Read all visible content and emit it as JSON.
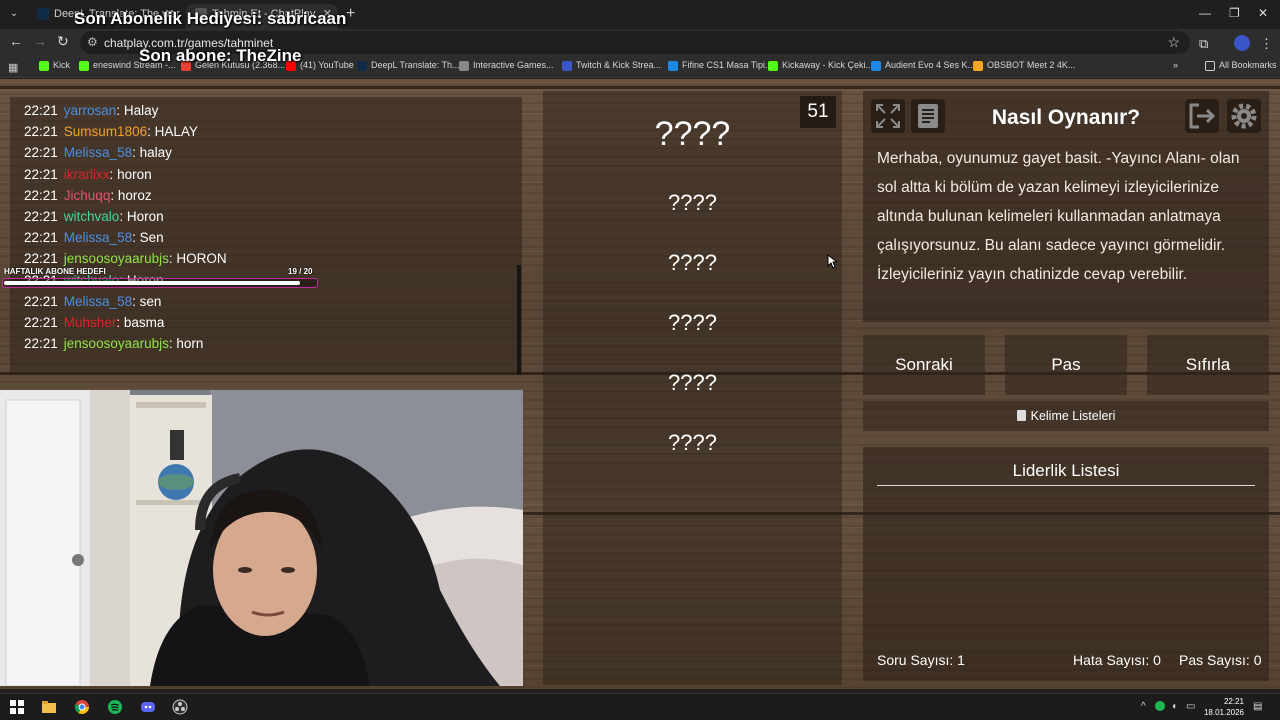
{
  "browser": {
    "tabs": [
      {
        "title": "DeepL Translate: The world's m",
        "favicon_color": "#0f2b46"
      },
      {
        "title": "Tahmin Et - ChatPlay",
        "favicon_color": "#555555"
      }
    ],
    "url": "chatplay.com.tr/games/tahminet",
    "bookmarks": [
      {
        "label": "Kick",
        "color": "#53fc18"
      },
      {
        "label": "eneswind Stream -...",
        "color": "#53fc18"
      },
      {
        "label": "Gelen Kutusu (2.368...",
        "color": "#ea4335"
      },
      {
        "label": "(41) YouTube",
        "color": "#ff0000"
      },
      {
        "label": "DeepL Translate: Th...",
        "color": "#0f2b46"
      },
      {
        "label": "Interactive Games...",
        "color": "#888888"
      },
      {
        "label": "Twitch & Kick Strea...",
        "color": "#3a55c8"
      },
      {
        "label": "Fifine CS1 Masa Tipi...",
        "color": "#1e88e5"
      },
      {
        "label": "Kickaway - Kick Çeki...",
        "color": "#53fc18"
      },
      {
        "label": "Audient Evo 4 Ses K...",
        "color": "#1e88e5"
      },
      {
        "label": "OBSBOT Meet 2 4K...",
        "color": "#f5a623"
      }
    ],
    "all_bookmarks": "All Bookmarks"
  },
  "overlay": {
    "sub_gift": "Son Abonelik Hediyesi: sabricaan",
    "last_sub": "Son abone: TheZine",
    "goal_label": "HAFTALIK ABONE HEDEFI",
    "goal_count": "19 / 20",
    "goal_progress": 0.95,
    "goal_color": "#c02aa0"
  },
  "chat": [
    {
      "time": "22:21",
      "user": "yarrosan",
      "color": "#4a8fe0",
      "msg": "Halay"
    },
    {
      "time": "22:21",
      "user": "Sumsum1806",
      "color": "#f0a030",
      "msg": "HALAY"
    },
    {
      "time": "22:21",
      "user": "Melissa_58",
      "color": "#4a8fe0",
      "msg": "halay"
    },
    {
      "time": "22:21",
      "user": "ikrarlixx",
      "color": "#d8232a",
      "msg": "horon"
    },
    {
      "time": "22:21",
      "user": "Jichuqq",
      "color": "#e2556a",
      "msg": "horoz"
    },
    {
      "time": "22:21",
      "user": "witchvalo",
      "color": "#49d49a",
      "msg": "Horon"
    },
    {
      "time": "22:21",
      "user": "Melissa_58",
      "color": "#4a8fe0",
      "msg": "Sen"
    },
    {
      "time": "22:21",
      "user": "jensoosoyaarubjs",
      "color": "#8fe34a",
      "msg": "HORON"
    },
    {
      "time": "22:21",
      "user": "witchvalo",
      "color": "#49d49a",
      "msg": "Horon"
    },
    {
      "time": "22:21",
      "user": "Melissa_58",
      "color": "#4a8fe0",
      "msg": "sen"
    },
    {
      "time": "22:21",
      "user": "Muhsher",
      "color": "#d8232a",
      "msg": "basma"
    },
    {
      "time": "22:21",
      "user": "jensoosoyaarubjs",
      "color": "#8fe34a",
      "msg": "horn"
    }
  ],
  "game": {
    "timer": "51",
    "main_word": "????",
    "words": [
      "????",
      "????",
      "????",
      "????",
      "????"
    ]
  },
  "howto": {
    "title": "Nasıl Oynanır?",
    "text": "Merhaba, oyunumuz gayet basit. -Yayıncı Alanı- olan sol altta ki bölüm de yazan kelimeyi izleyicilerinize altında bulunan kelimeleri kullanmadan anlatmaya çalışıyorsunuz. Bu alanı sadece yayıncı görmelidir. İzleyicileriniz yayın chatinizde cevap verebilir."
  },
  "controls": {
    "next": "Sonraki",
    "pass": "Pas",
    "reset": "Sıfırla",
    "word_lists": "Kelime Listeleri"
  },
  "leaderboard": {
    "title": "Liderlik Listesi",
    "question_count": "Soru Sayısı: 1",
    "error_count": "Hata Sayısı: 0",
    "pass_count": "Pas Sayısı: 0"
  },
  "taskbar": {
    "time": "22:21",
    "date": "18.01.2026"
  }
}
